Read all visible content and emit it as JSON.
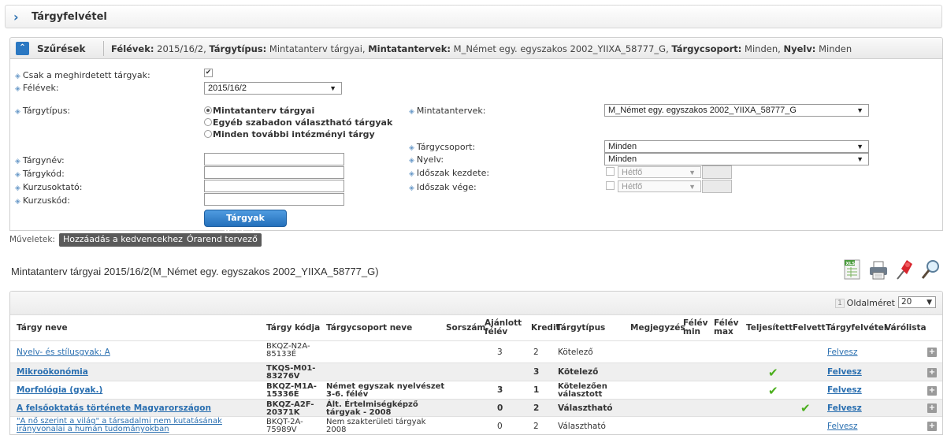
{
  "page": {
    "title": "Tárgyfelvétel"
  },
  "filter_bar": {
    "label": "Szűrések",
    "summary": [
      {
        "key": "Félévek:",
        "value": "2015/16/2,"
      },
      {
        "key": "Tárgytípus:",
        "value": "Mintatanterv tárgyai,"
      },
      {
        "key": "Mintatantervek:",
        "value": "M_Német egy. egyszakos 2002_YIIXA_58777_G,"
      },
      {
        "key": "Tárgycsoport:",
        "value": "Minden,"
      },
      {
        "key": "Nyelv:",
        "value": "Minden"
      }
    ]
  },
  "filters": {
    "only_announced_label": "Csak a meghirdetett tárgyak:",
    "only_announced_checked": true,
    "semesters_label": "Félévek:",
    "semesters_value": "2015/16/2",
    "subject_type_label": "Tárgytípus:",
    "subject_type_options": [
      "Mintatanterv tárgyai",
      "Egyéb szabadon választható tárgyak",
      "Minden további intézményi tárgy"
    ],
    "curricula_label": "Mintatantervek:",
    "curricula_value": "M_Német egy. egyszakos 2002_YIIXA_58777_G",
    "subject_group_label": "Tárgycsoport:",
    "subject_group_value": "Minden",
    "language_label": "Nyelv:",
    "language_value": "Minden",
    "subject_name_label": "Tárgynév:",
    "subject_code_label": "Tárgykód:",
    "instructor_label": "Kurzusoktató:",
    "course_code_label": "Kurzuskód:",
    "period_start_label": "Időszak kezdete:",
    "period_end_label": "Időszak vége:",
    "day_value": "Hétfő",
    "list_button": "Tárgyak listázása"
  },
  "actions": {
    "label": "Műveletek:",
    "add_favorites": "Hozzáadás a kedvencekhez",
    "timetable_planner": "Órarend tervező"
  },
  "list": {
    "title": "Mintatanterv tárgyai 2015/16/2(M_Német egy. egyszakos 2002_YIIXA_58777_G)",
    "toolbar_icons": [
      "xls-export-icon",
      "print-icon",
      "pin-icon",
      "search-icon"
    ],
    "page_number": "1",
    "per_page_label": "Oldalméret",
    "per_page_value": "20",
    "headers": {
      "name": "Tárgy neve",
      "code": "Tárgy kódja",
      "group": "Tárgycsoport neve",
      "order": "Sorszám",
      "recommended_1": "Ajánlott",
      "recommended_2": "félév",
      "credit": "Kredit",
      "type": "Tárgytípus",
      "note": "Megjegyzés",
      "sem_min_1": "Félév",
      "sem_min_2": "min",
      "sem_max_1": "Félév",
      "sem_max_2": "max",
      "completed": "Teljesített",
      "taken": "Felvett",
      "registration": "Tárgyfelvétel",
      "waitlist": "Várólista"
    },
    "rows": [
      {
        "name_lines": [
          "Nyelv- és stílusgyak: A"
        ],
        "code_lines": [
          "BKQZ-N2A-",
          "85133É"
        ],
        "group_lines": [],
        "recommended": "3",
        "credit": "2",
        "type_lines": [
          "Kötelező"
        ],
        "completed": false,
        "taken": false,
        "action": "Felvesz",
        "bold": false,
        "alt": false
      },
      {
        "name_lines": [
          "Mikroökonómia"
        ],
        "code_lines": [
          "TKQS-M01-",
          "83276V"
        ],
        "group_lines": [],
        "recommended": "",
        "credit": "3",
        "type_lines": [
          "Kötelező"
        ],
        "completed": true,
        "taken": false,
        "action": "Felvesz",
        "bold": true,
        "alt": true
      },
      {
        "name_lines": [
          "Morfológia (gyak.)"
        ],
        "code_lines": [
          "BKQZ-M1A-",
          "15336É"
        ],
        "group_lines": [
          "Német egyszak nyelvészet",
          "3-6. félév"
        ],
        "recommended": "3",
        "credit": "1",
        "type_lines": [
          "Kötelezően",
          "választott"
        ],
        "completed": true,
        "taken": false,
        "action": "Felvesz",
        "bold": true,
        "alt": false
      },
      {
        "name_lines": [
          "A felsőoktatás története Magyarországon"
        ],
        "code_lines": [
          "BKQZ-A2F-",
          "20371K"
        ],
        "group_lines": [
          "Ált. Értelmiségképző",
          "tárgyak - 2008"
        ],
        "recommended": "0",
        "credit": "2",
        "type_lines": [
          "Választható"
        ],
        "completed": false,
        "taken": true,
        "action": "Felvesz",
        "bold": true,
        "alt": true
      },
      {
        "name_lines": [
          "\"A nő szerint a világ\" a társadalmi nem kutatásának",
          "irányvonalai a humán tudományokban"
        ],
        "code_lines": [
          "BKQT-2A-",
          "75989V"
        ],
        "group_lines": [
          "Nem szakterületi tárgyak",
          "2008"
        ],
        "recommended": "0",
        "credit": "2",
        "type_lines": [
          "Választható"
        ],
        "completed": false,
        "taken": false,
        "action": "Felvesz",
        "bold": false,
        "alt": false
      }
    ]
  }
}
